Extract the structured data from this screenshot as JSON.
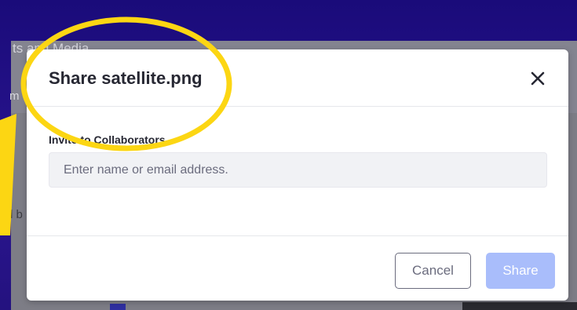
{
  "background": {
    "page_title": "ts and Media",
    "subtitle": "m",
    "body_fragment": "d b"
  },
  "dialog": {
    "title": "Share satellite.png",
    "close_icon": "close-icon",
    "invite_label": "Invite to Collaborators",
    "invite_placeholder": "Enter name or email address.",
    "invite_value": "",
    "cancel_label": "Cancel",
    "share_label": "Share"
  },
  "colors": {
    "annotation": "#fcd613",
    "share_disabled": "#a9bdfb",
    "backdrop": "#1e0d84"
  }
}
